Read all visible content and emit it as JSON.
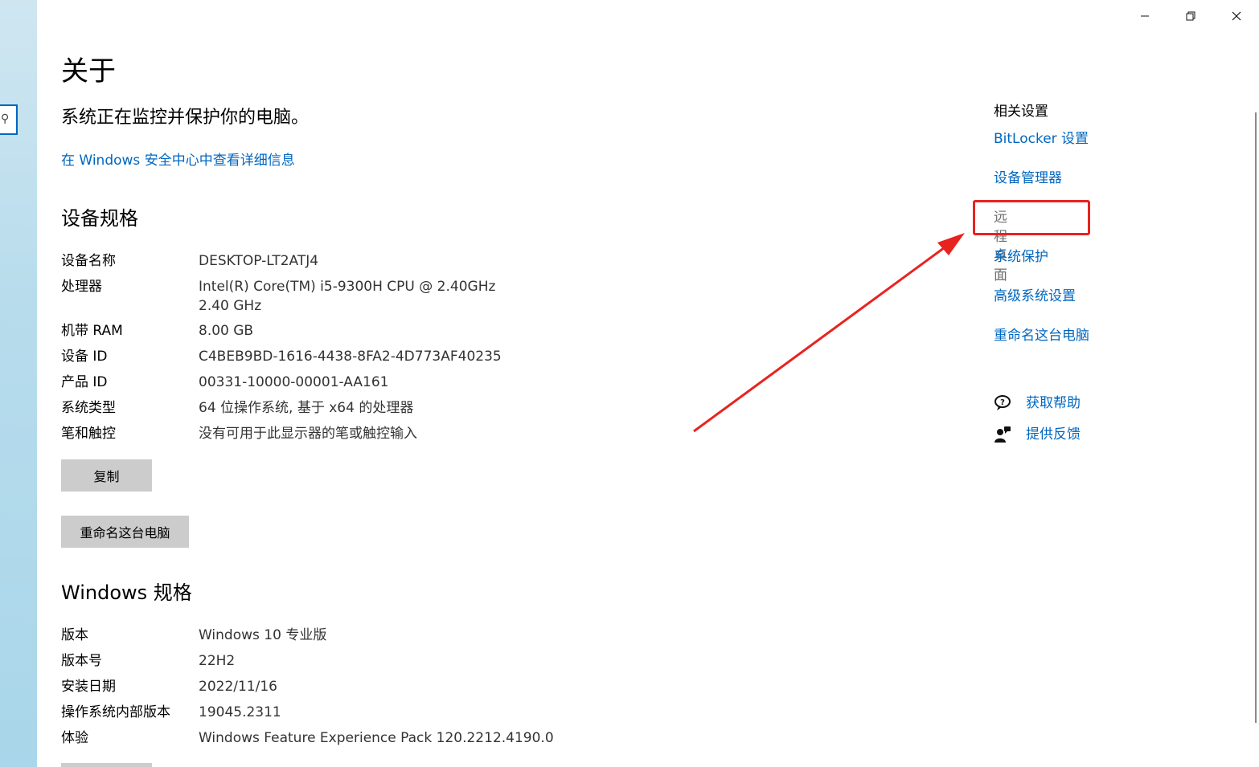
{
  "window": {
    "minimize_icon": "minimize-icon",
    "restore_icon": "restore-icon",
    "close_icon": "close-icon"
  },
  "sidebar": {
    "search_icon": "search-icon",
    "search_glyph": "⚲"
  },
  "page": {
    "title": "关于",
    "subtitle": "系统正在监控并保护你的电脑。",
    "security_link": "在 Windows 安全中心中查看详细信息"
  },
  "device_specs": {
    "heading": "设备规格",
    "rows": [
      {
        "label": "设备名称",
        "value": "DESKTOP-LT2ATJ4"
      },
      {
        "label": "处理器",
        "value": "Intel(R) Core(TM) i5-9300H CPU @ 2.40GHz   2.40 GHz"
      },
      {
        "label": "机带 RAM",
        "value": "8.00 GB"
      },
      {
        "label": "设备 ID",
        "value": "C4BEB9BD-1616-4438-8FA2-4D773AF40235"
      },
      {
        "label": "产品 ID",
        "value": "00331-10000-00001-AA161"
      },
      {
        "label": "系统类型",
        "value": "64 位操作系统, 基于 x64 的处理器"
      },
      {
        "label": "笔和触控",
        "value": "没有可用于此显示器的笔或触控输入"
      }
    ],
    "copy_button": "复制",
    "rename_button": "重命名这台电脑"
  },
  "windows_specs": {
    "heading": "Windows 规格",
    "rows": [
      {
        "label": "版本",
        "value": "Windows 10 专业版"
      },
      {
        "label": "版本号",
        "value": "22H2"
      },
      {
        "label": "安装日期",
        "value": "2022/11/16"
      },
      {
        "label": "操作系统内部版本",
        "value": "19045.2311"
      },
      {
        "label": "体验",
        "value": "Windows Feature Experience Pack 120.2212.4190.0"
      }
    ]
  },
  "related_settings": {
    "heading": "相关设置",
    "links": [
      {
        "label": "BitLocker 设置"
      },
      {
        "label": "设备管理器"
      },
      {
        "label": "远程桌面"
      },
      {
        "label": "系统保护"
      },
      {
        "label": "高级系统设置"
      },
      {
        "label": "重命名这台电脑"
      }
    ],
    "help": [
      {
        "label": "获取帮助",
        "icon": "help-chat-icon"
      },
      {
        "label": "提供反馈",
        "icon": "feedback-person-icon"
      }
    ]
  },
  "colors": {
    "link": "#0067c0",
    "annotation_red": "#e8231f",
    "button_gray": "#cccccc"
  }
}
